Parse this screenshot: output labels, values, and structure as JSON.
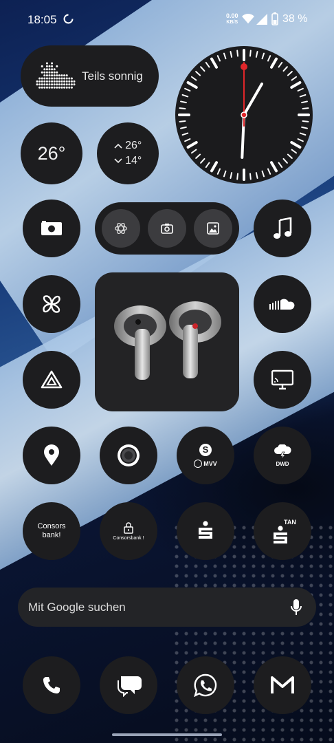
{
  "status_bar": {
    "time": "18:05",
    "net_speed_value": "0.00",
    "net_speed_unit": "KB/S",
    "battery_percent": "38 %"
  },
  "weather": {
    "condition": "Teils sonnig",
    "current_temp": "26°",
    "high": "26°",
    "low": "14°",
    "high_arrow": "^",
    "low_arrow": "v"
  },
  "clock": {
    "hour": 18,
    "minute": 5,
    "accent_color": "#e0262a"
  },
  "quick_bar": {
    "buttons": [
      "chatgpt-icon",
      "camera-icon",
      "gallery-icon"
    ]
  },
  "apps": {
    "row1": [
      "camera-app",
      "quick-bar",
      "music-app"
    ],
    "row2": [
      "fan-app",
      "earbuds-widget",
      "soundcloud-app"
    ],
    "row3": [
      "drive-app",
      "cast-app"
    ],
    "row4": [
      "maps-app",
      "camera-lens-app",
      "mvv-app",
      "dwd-app"
    ],
    "consors_label1": "Consors",
    "consors_label2": "bank!",
    "consors_secure_label": "Consorsbank !",
    "mvv_s": "S",
    "mvv_brand": "MVV",
    "dwd_label": "DWD",
    "tan_label": "TAN"
  },
  "search": {
    "placeholder": "Mit Google suchen"
  },
  "dock": [
    "phone-app",
    "messages-app",
    "whatsapp-app",
    "gmail-app"
  ]
}
